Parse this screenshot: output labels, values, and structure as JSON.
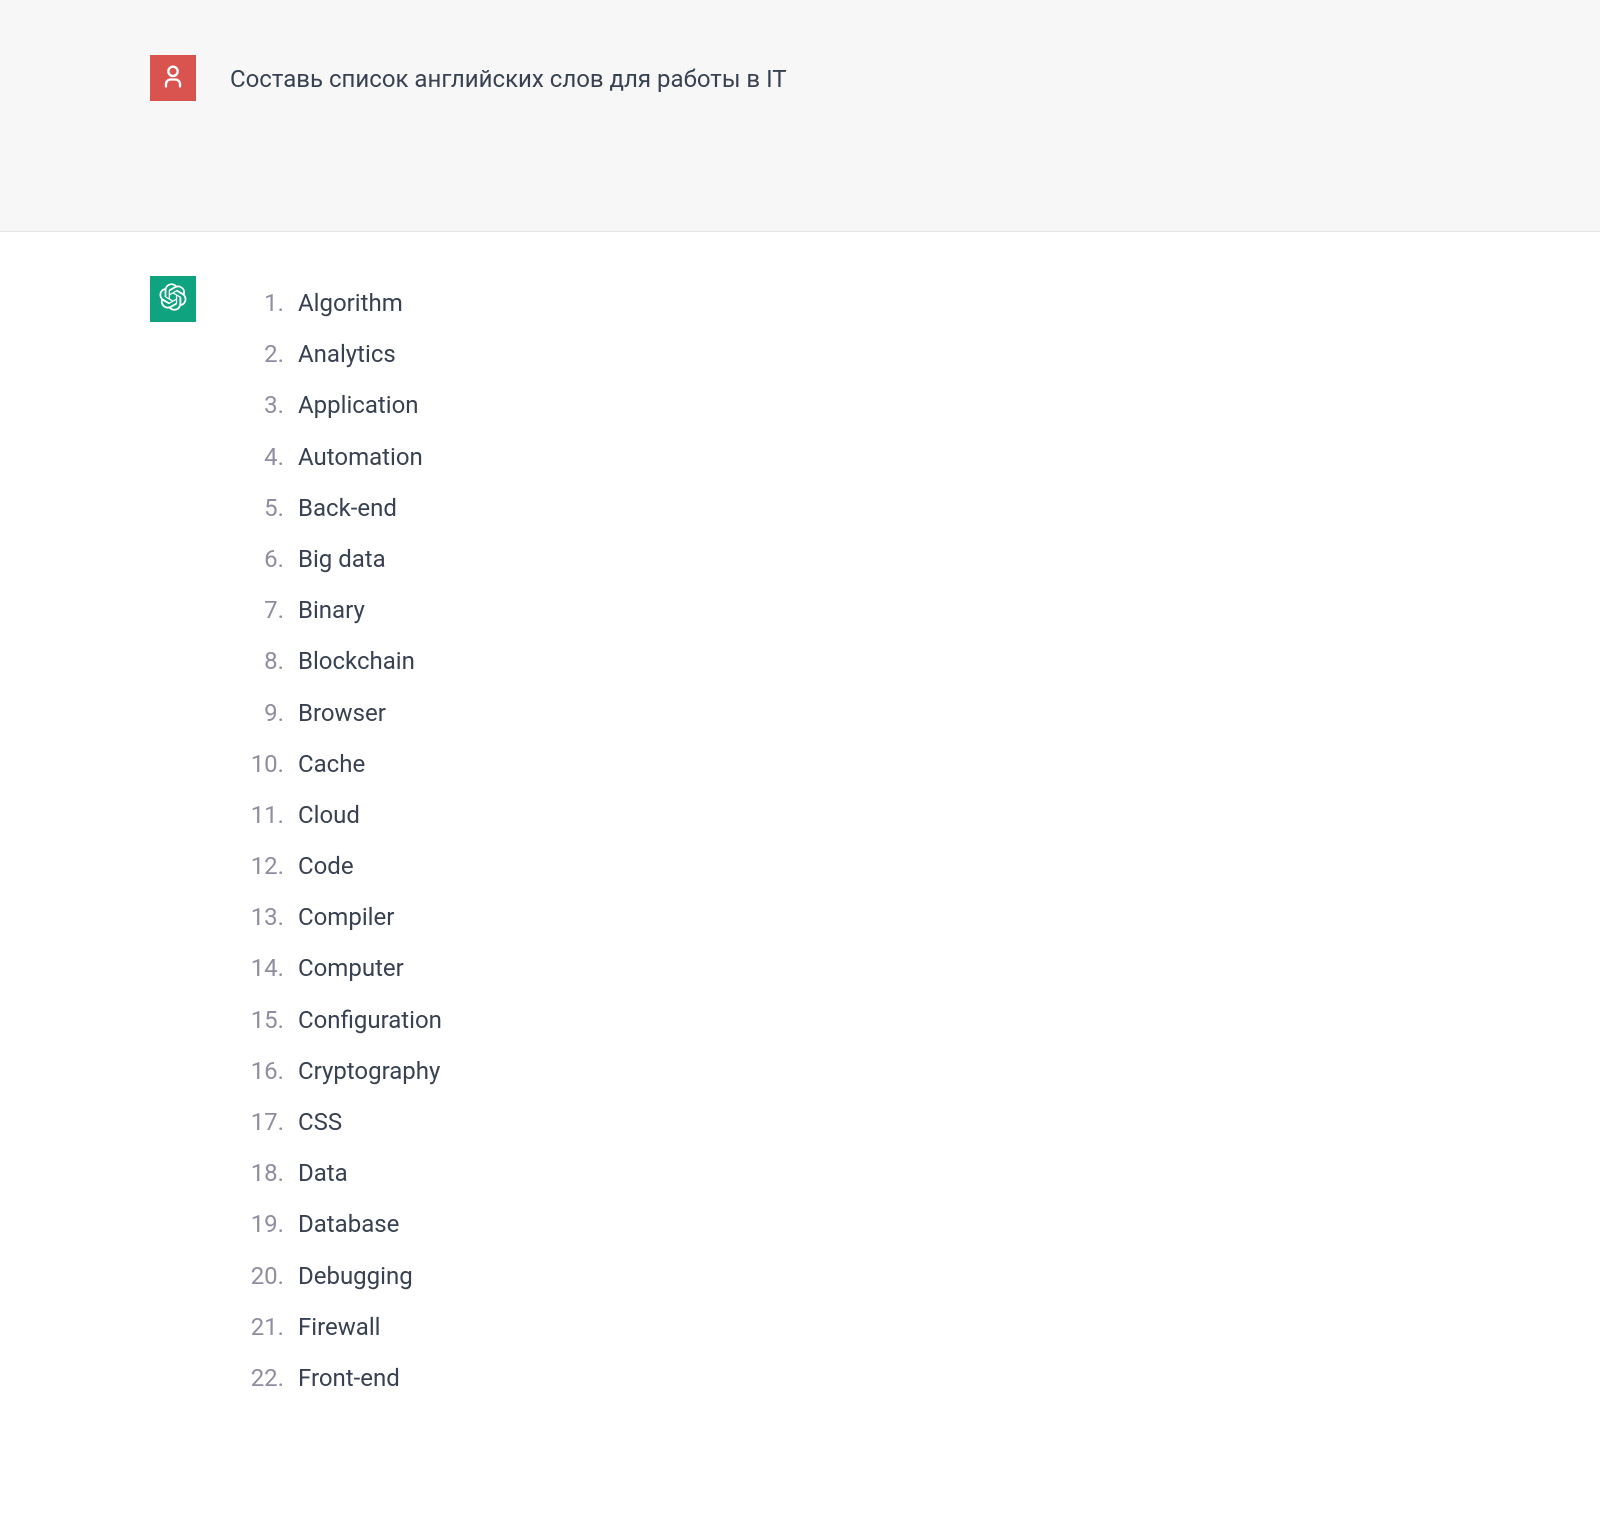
{
  "user": {
    "message": "Составь список английских слов для работы в IT"
  },
  "assistant": {
    "list_items": [
      "Algorithm",
      "Analytics",
      "Application",
      "Automation",
      "Back-end",
      "Big data",
      "Binary",
      "Blockchain",
      "Browser",
      "Cache",
      "Cloud",
      "Code",
      "Compiler",
      "Computer",
      "Configuration",
      "Cryptography",
      "CSS",
      "Data",
      "Database",
      "Debugging",
      "Firewall",
      "Front-end"
    ]
  },
  "colors": {
    "user_avatar_bg": "#d9534f",
    "assistant_avatar_bg": "#10a37f",
    "user_section_bg": "#f7f7f8",
    "text": "#374151",
    "list_number": "#8e8ea0"
  }
}
